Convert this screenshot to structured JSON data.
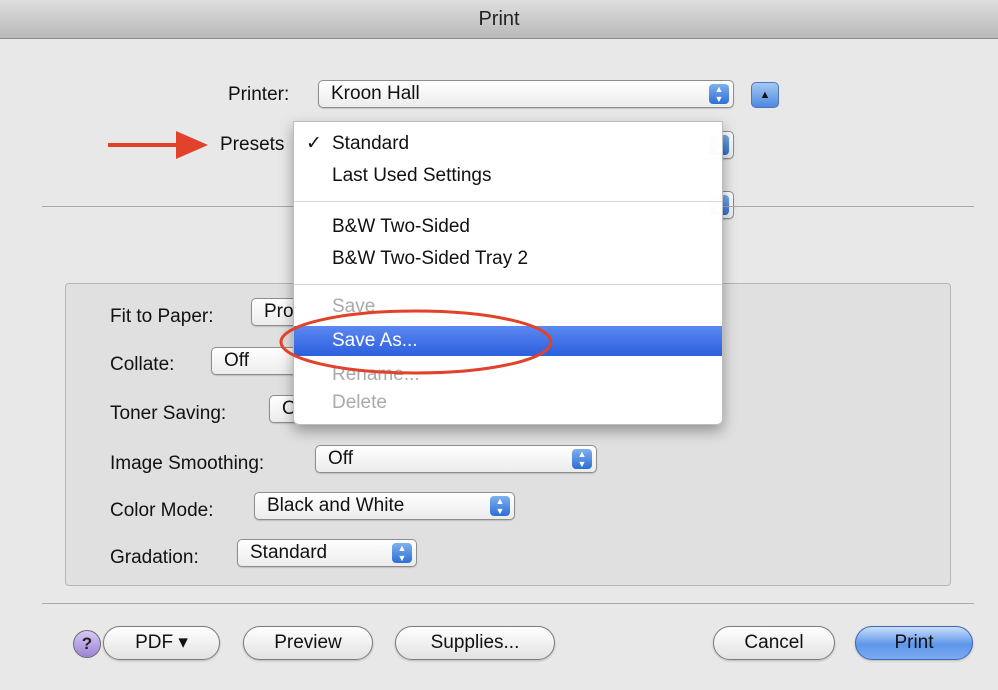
{
  "window": {
    "title": "Print"
  },
  "printer": {
    "label": "Printer:",
    "value": "Kroon Hall"
  },
  "presets": {
    "label": "Presets"
  },
  "presets_menu": {
    "check_mark": "✓",
    "items": [
      {
        "label": "Standard",
        "checked": true,
        "enabled": true,
        "highlighted": false
      },
      {
        "label": "Last Used Settings",
        "enabled": true
      },
      {
        "label": "B&W Two-Sided",
        "enabled": true
      },
      {
        "label": "B&W Two-Sided Tray 2",
        "enabled": true
      },
      {
        "label": "Save",
        "enabled": false
      },
      {
        "label": "Save As...",
        "enabled": true,
        "highlighted": true
      },
      {
        "label": "Rename...",
        "enabled": false
      },
      {
        "label": "Delete",
        "enabled": false
      }
    ]
  },
  "settings": {
    "fit_to_paper": {
      "label": "Fit to Paper:",
      "value": "Pro"
    },
    "collate": {
      "label": "Collate:",
      "value": "Off"
    },
    "toner_saving": {
      "label": "Toner Saving:",
      "value": "O"
    },
    "image_smoothing": {
      "label": "Image Smoothing:",
      "value": "Off"
    },
    "color_mode": {
      "label": "Color Mode:",
      "value": "Black and White"
    },
    "gradation": {
      "label": "Gradation:",
      "value": "Standard"
    }
  },
  "buttons": {
    "help": "?",
    "pdf": "PDF ▾",
    "preview": "Preview",
    "supplies": "Supplies...",
    "cancel": "Cancel",
    "print": "Print"
  },
  "colors": {
    "menu_highlight": "#2a5fde",
    "annotation_red": "#e2412a",
    "default_button": "#5d96ea"
  }
}
